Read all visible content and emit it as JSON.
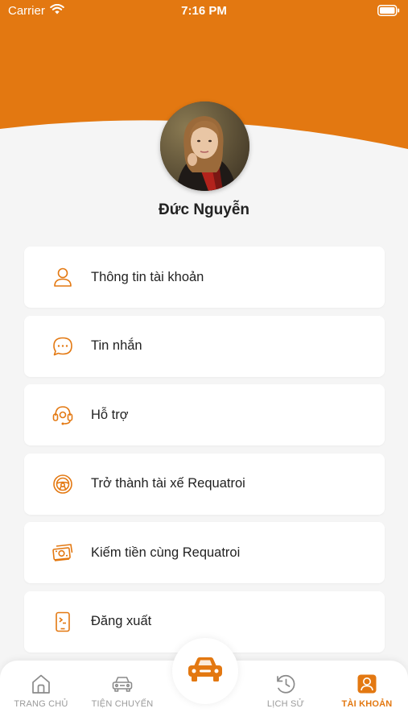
{
  "colors": {
    "accent": "#e37811",
    "background": "#f5f5f5",
    "card": "#ffffff"
  },
  "status_bar": {
    "carrier": "Carrier",
    "time": "7:16 PM"
  },
  "profile": {
    "name": "Đức Nguyễn"
  },
  "menu": {
    "items": [
      {
        "label": "Thông tin tài khoản",
        "icon": "user-icon"
      },
      {
        "label": "Tin nhắn",
        "icon": "chat-bubble-icon"
      },
      {
        "label": "Hỗ trợ",
        "icon": "headset-icon"
      },
      {
        "label": "Trở thành tài xế Requatroi",
        "icon": "steering-wheel-icon"
      },
      {
        "label": "Kiếm tiền cùng Requatroi",
        "icon": "money-icon"
      },
      {
        "label": "Đăng xuất",
        "icon": "logout-phone-icon"
      }
    ]
  },
  "tabbar": {
    "tabs": [
      {
        "label": "TRANG CHỦ",
        "icon": "home-icon",
        "active": false
      },
      {
        "label": "TIỆN CHUYẾN",
        "icon": "car-outline-icon",
        "active": false
      },
      {
        "label": "LỊCH SỬ",
        "icon": "history-icon",
        "active": false
      },
      {
        "label": "TÀI KHOẢN",
        "icon": "account-icon",
        "active": true
      }
    ],
    "center_icon": "car-icon"
  }
}
